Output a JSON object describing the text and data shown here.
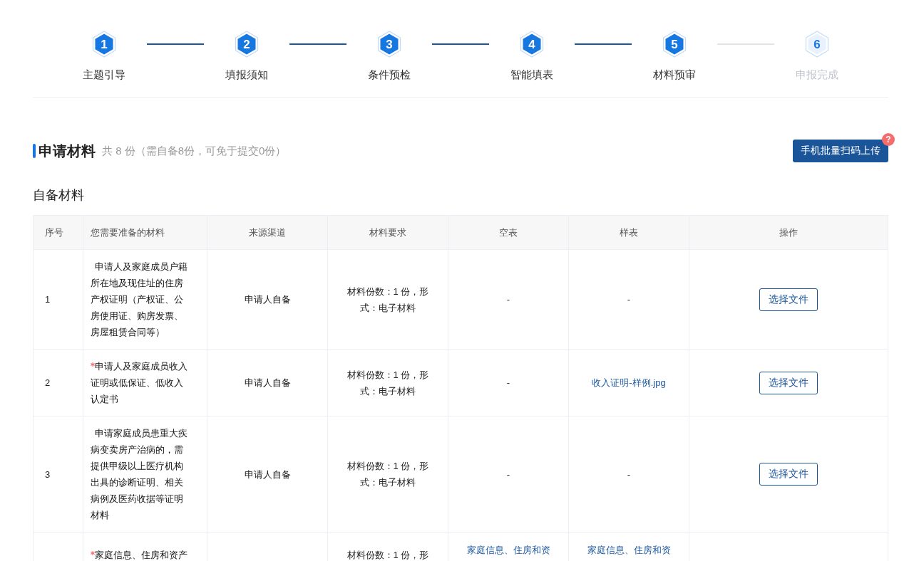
{
  "steps": [
    {
      "number": "1",
      "label": "主题引导",
      "completed": true
    },
    {
      "number": "2",
      "label": "填报须知",
      "completed": true
    },
    {
      "number": "3",
      "label": "条件预检",
      "completed": true
    },
    {
      "number": "4",
      "label": "智能填表",
      "completed": true
    },
    {
      "number": "5",
      "label": "材料预审",
      "completed": true
    },
    {
      "number": "6",
      "label": "申报完成",
      "completed": false
    }
  ],
  "section": {
    "title": "申请材料",
    "summary": "共 8 份（需自备8份，可免于提交0份）",
    "upload_button": {
      "label": "手机批量扫码上传",
      "badge": "?"
    }
  },
  "subsection": {
    "title": "自备材料"
  },
  "table": {
    "columns": [
      "序号",
      "您需要准备的材料",
      "来源渠道",
      "材料要求",
      "空表",
      "样表",
      "操作"
    ],
    "rows": [
      {
        "no": "1",
        "material": "申请人及家庭成员户籍所在地及现住址的住房产权证明（产权证、公房使用证、购房发票、房屋租赁合同等）",
        "required": false,
        "source": "申请人自备",
        "requirement": "材料份数：1 份，形式：电子材料",
        "blank_form": {
          "text": "-",
          "kind": "empty"
        },
        "sample": {
          "text": "-",
          "kind": "empty"
        },
        "action": "选择文件"
      },
      {
        "no": "2",
        "material": "申请人及家庭成员收入证明或低保证、低收入认定书",
        "required": true,
        "source": "申请人自备",
        "requirement": "材料份数：1 份，形式：电子材料",
        "blank_form": {
          "text": "-",
          "kind": "empty"
        },
        "sample": {
          "text": "收入证明-样例.jpg",
          "kind": "link"
        },
        "action": "选择文件"
      },
      {
        "no": "3",
        "material": "申请家庭成员患重大疾病变卖房产治病的，需提供甲级以上医疗机构出具的诊断证明、相关病例及医药收据等证明材料",
        "required": false,
        "source": "申请人自备",
        "requirement": "材料份数：1 份，形式：电子材料",
        "blank_form": {
          "text": "-",
          "kind": "empty"
        },
        "sample": {
          "text": "-",
          "kind": "empty"
        },
        "action": "选择文件"
      },
      {
        "material": "家庭信息、住房和资产",
        "required": true,
        "requirement": "材料份数：1 份，形",
        "blank_form": {
          "text": "家庭信息、住房和资",
          "kind": "link"
        },
        "sample": {
          "text": "家庭信息、住房和资",
          "kind": "link"
        }
      }
    ]
  }
}
